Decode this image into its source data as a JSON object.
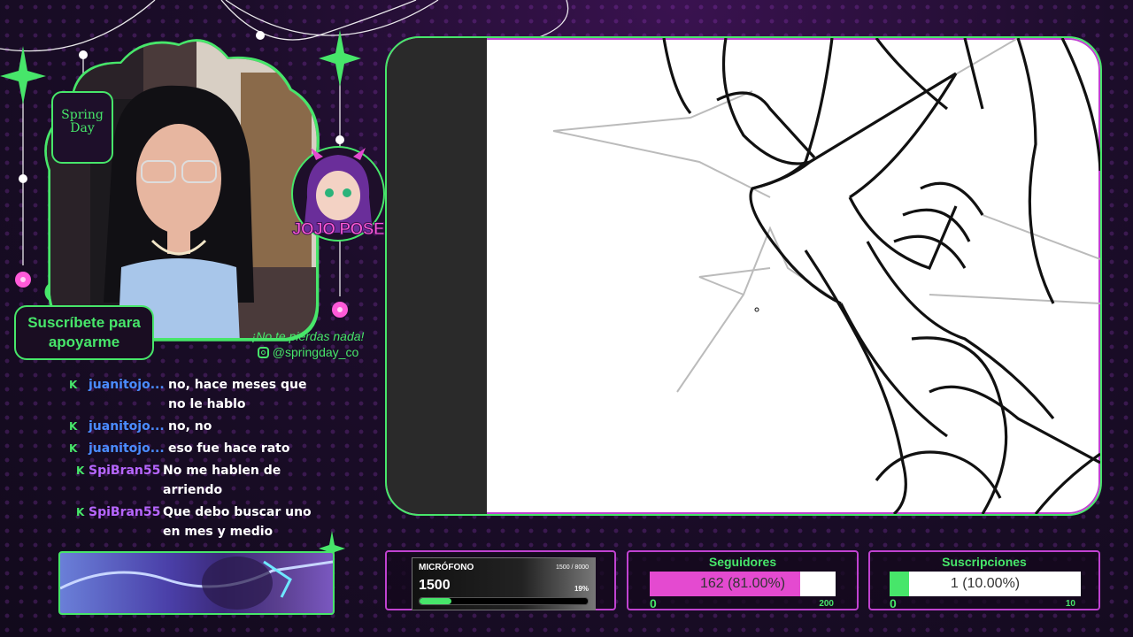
{
  "colors": {
    "accent_green": "#47e66a",
    "accent_pink": "#e44ad0",
    "frame_pink": "#c042d0",
    "user_blue": "#4a8cff",
    "user_purple": "#b766ff"
  },
  "overlay": {
    "badge_text": "Spring Day",
    "subscribe_text": "Suscríbete para apoyarme",
    "emote_label": "JOJO POSE",
    "social_tagline": "¡No te pierdas nada!",
    "social_handle": "@springday_co"
  },
  "chat": [
    {
      "icon": "kick-icon",
      "user": "juanitojo...",
      "color": "blue",
      "text": "no, hace meses que no le hablo"
    },
    {
      "icon": "kick-icon",
      "user": "juanitojo...",
      "color": "blue",
      "text": "no, no"
    },
    {
      "icon": "kick-icon",
      "user": "juanitojo...",
      "color": "blue",
      "text": "eso fue hace rato"
    },
    {
      "icon": "kick-icon",
      "user": "SpiBran55",
      "color": "purple",
      "text": "No me hablen de arriendo"
    },
    {
      "icon": "kick-icon",
      "user": "SpiBran55",
      "color": "purple",
      "text": "Que debo buscar uno en mes y medio"
    }
  ],
  "microphone": {
    "title": "MICRÓFONO",
    "range": "1500 / 8000",
    "value": "1500",
    "percent": "19%",
    "progress": 0.19
  },
  "followers": {
    "title": "Seguidores",
    "text": "162 (81.00%)",
    "min": "0",
    "max": "200",
    "progress": 0.81
  },
  "subscriptions": {
    "title": "Suscripciones",
    "text": "1 (10.00%)",
    "min": "0",
    "max": "10",
    "progress": 0.1
  }
}
